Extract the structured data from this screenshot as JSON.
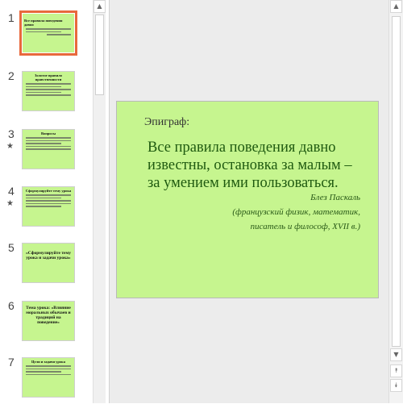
{
  "thumbnails": [
    {
      "num": "1",
      "title": "Все правила поведения давно",
      "star": ""
    },
    {
      "num": "2",
      "title": "Золотое правило нравственности",
      "star": ""
    },
    {
      "num": "3",
      "title": "Вопросы",
      "star": "★"
    },
    {
      "num": "4",
      "title": "Сформулируйте тему урока",
      "star": "★"
    },
    {
      "num": "5",
      "title": "«Сформулируйте тему урока и задачи урока»",
      "star": ""
    },
    {
      "num": "6",
      "title": "Тема урока: «Влияние моральных обычаев и традиций на поведение»",
      "star": ""
    },
    {
      "num": "7",
      "title": "Цели и задачи урока",
      "star": ""
    }
  ],
  "scroll": {
    "up": "▲",
    "down": "▼",
    "prev_slide": "⯭",
    "next_slide": "⯯"
  },
  "slide": {
    "epigraph_label": "Эпиграф:",
    "quote": "Все правила поведения давно известны, остановка за малым – за умением ими пользоваться.",
    "author_name": "Блез Паскаль",
    "author_desc": "(французский физик, математик, писатель и философ, XVII в.)"
  }
}
